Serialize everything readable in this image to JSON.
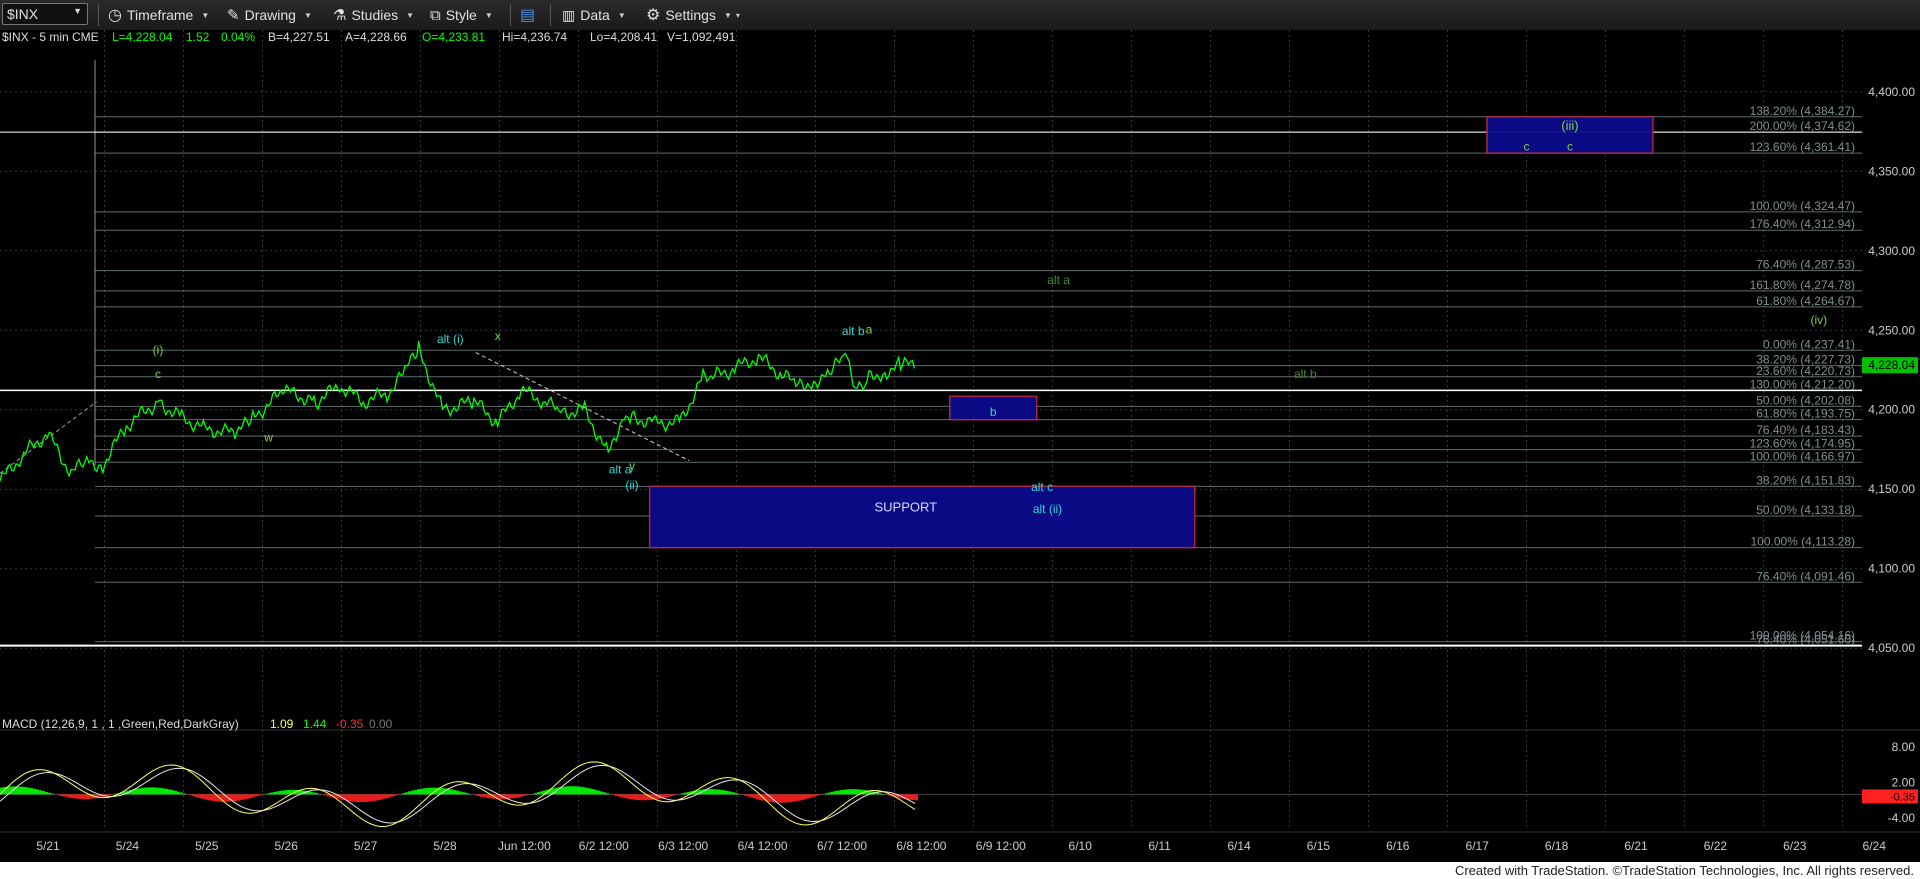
{
  "toolbar": {
    "symbol": "$INX",
    "timeframe": "Timeframe",
    "drawing": "Drawing",
    "studies": "Studies",
    "style": "Style",
    "data": "Data",
    "settings": "Settings"
  },
  "status_bar": {
    "prefix": "$INX - 5 min  CME",
    "last": "L=4,228.04",
    "change": "1.52",
    "change_pct": "0.04%",
    "bid": "B=4,227.51",
    "ask": "A=4,228.66",
    "open": "O=4,233.81",
    "high": "Hi=4,236.74",
    "low": "Lo=4,208.41",
    "volume": "V=1,092,491"
  },
  "colors": {
    "price_line": "#00ff00",
    "grid": "#2a3a3a",
    "fib_text": "#7f8f8f",
    "support_box": "#0b0b8c",
    "support_border": "#b0284a",
    "wave_label": "#2fd8d8",
    "green_label": "#7bd63a",
    "macd_line": "#ffff66",
    "signal_line": "#e8e8e8",
    "hist_up": "#00ff00",
    "hist_down": "#ff2020"
  },
  "chart_data": {
    "type": "line",
    "symbol": "$INX",
    "interval": "5 min",
    "ylim": [
      4030,
      4420
    ],
    "y_ticks": [
      "4,050.00",
      "4,100.00",
      "4,150.00",
      "4,200.00",
      "4,250.00",
      "4,300.00",
      "4,350.00",
      "4,400.00"
    ],
    "x_tick_labels": [
      "5/21",
      "5/24",
      "5/25",
      "5/26",
      "5/27",
      "5/28",
      "Jun 12:00",
      "6/2 12:00",
      "6/3 12:00",
      "6/4 12:00",
      "6/7 12:00",
      "6/8 12:00",
      "6/9 12:00",
      "6/10",
      "6/11",
      "6/14",
      "6/15",
      "6/16",
      "6/17",
      "6/18",
      "6/21",
      "6/22",
      "6/23",
      "6/24"
    ],
    "last_price_label": "4,228.04",
    "price_series": {
      "name": "$INX",
      "x_session": [
        0,
        0.3,
        0.6,
        0.9,
        1.1,
        1.3,
        1.6,
        2.0,
        2.3,
        2.6,
        3.0,
        3.2,
        3.6,
        4.0,
        4.3,
        4.6,
        4.9,
        5.1,
        5.3,
        5.6,
        6.0,
        6.3,
        6.6,
        6.9,
        7.1,
        7.4,
        7.7,
        7.9,
        8.0,
        8.3,
        8.6,
        8.9,
        9.0,
        9.3,
        9.6,
        9.9,
        10.1,
        10.3,
        10.5,
        10.7,
        10.85,
        11.0,
        11.2,
        11.4,
        11.6
      ],
      "price": [
        4155,
        4172,
        4185,
        4160,
        4168,
        4165,
        4190,
        4205,
        4195,
        4188,
        4185,
        4195,
        4212,
        4205,
        4215,
        4205,
        4210,
        4222,
        4238,
        4200,
        4205,
        4192,
        4212,
        4205,
        4198,
        4200,
        4172,
        4198,
        4195,
        4192,
        4192,
        4220,
        4220,
        4226,
        4233,
        4222,
        4215,
        4218,
        4222,
        4235,
        4212,
        4220,
        4224,
        4228,
        4228
      ]
    },
    "fib_levels": [
      {
        "label": "138.20% (4,384.27)",
        "value": 4384.27
      },
      {
        "label": "200.00% (4,374.62)",
        "value": 4374.62
      },
      {
        "label": "123.60% (4,361.41)",
        "value": 4361.41
      },
      {
        "label": "100.00% (4,324.47)",
        "value": 4324.47
      },
      {
        "label": "176.40% (4,312.94)",
        "value": 4312.94
      },
      {
        "label": "76.40% (4,287.53)",
        "value": 4287.53
      },
      {
        "label": "161.80% (4,274.78)",
        "value": 4274.78
      },
      {
        "label": "61.80% (4,264.67)",
        "value": 4264.67
      },
      {
        "label": "0.00% (4,237.41)",
        "value": 4237.41
      },
      {
        "label": "38.20% (4,227.73)",
        "value": 4227.73
      },
      {
        "label": "23.60% (4,220.73)",
        "value": 4220.73
      },
      {
        "label": "130.00% (4,212.20)",
        "value": 4212.2
      },
      {
        "label": "50.00% (4,202.08)",
        "value": 4202.08
      },
      {
        "label": "61.80% (4,193.75)",
        "value": 4193.75
      },
      {
        "label": "76.40% (4,183.43)",
        "value": 4183.43
      },
      {
        "label": "123.60% (4,174.95)",
        "value": 4174.95
      },
      {
        "label": "100.00% (4,166.97)",
        "value": 4166.97
      },
      {
        "label": "38.20% (4,151.83)",
        "value": 4151.83
      },
      {
        "label": "50.00% (4,133.18)",
        "value": 4133.18
      },
      {
        "label": "100.00% (4,113.28)",
        "value": 4113.28
      },
      {
        "label": "76.40% (4,091.46)",
        "value": 4091.46
      },
      {
        "label": "100.00% (4,054.16)",
        "value": 4054.16
      },
      {
        "label": "76.40% (4,051.60)",
        "value": 4051.6
      }
    ],
    "zones": [
      {
        "name": "(iii) target",
        "session_start": 18.0,
        "session_end": 20.1,
        "low": 4361.41,
        "high": 4384.27,
        "labels": [
          "(iii)",
          "c"
        ]
      },
      {
        "name": "b zone",
        "session_start": 11.2,
        "session_end": 12.3,
        "low": 4193.75,
        "high": 4208.4,
        "labels": [
          "b"
        ]
      },
      {
        "name": "SUPPORT",
        "session_start": 7.4,
        "session_end": 14.3,
        "low": 4113.28,
        "high": 4151.83,
        "labels": [
          "SUPPORT",
          "alt c",
          "alt (ii)"
        ]
      }
    ],
    "wave_labels": [
      {
        "text": "(i)",
        "session": 2.0,
        "value": 4235,
        "color": "green"
      },
      {
        "text": "c",
        "session": 2.0,
        "value": 4220,
        "color": "green"
      },
      {
        "text": "w",
        "session": 3.4,
        "value": 4180,
        "color": "green"
      },
      {
        "text": "alt (i)",
        "session": 5.7,
        "value": 4242,
        "color": "cyan"
      },
      {
        "text": "x",
        "session": 6.3,
        "value": 4244,
        "color": "green"
      },
      {
        "text": "alt a",
        "session": 7.85,
        "value": 4160,
        "color": "cyan"
      },
      {
        "text": "y",
        "session": 8.0,
        "value": 4162,
        "color": "green"
      },
      {
        "text": "(ii)",
        "session": 8.0,
        "value": 4150,
        "color": "cyan"
      },
      {
        "text": "alt b",
        "session": 10.8,
        "value": 4247,
        "color": "cyan"
      },
      {
        "text": "a",
        "session": 11.0,
        "value": 4248,
        "color": "green"
      },
      {
        "text": "alt a",
        "session": 13.4,
        "value": 4279,
        "color": "darkgreen"
      },
      {
        "text": "alt b",
        "session": 15.7,
        "value": 4220,
        "color": "darkgreen"
      },
      {
        "text": "(iv)",
        "session": 22.2,
        "value": 4254,
        "color": "green"
      },
      {
        "text": "c",
        "session": 18.5,
        "value": 4363,
        "color": "green"
      }
    ],
    "macd": {
      "label": "MACD (12,26,9, 1 , 1 ,Green,Red,DarkGray)",
      "macd_value": "1.09",
      "signal_value": "1.44",
      "hist_value": "-0.35",
      "zero_value": "0.00",
      "ylim": [
        -6,
        10
      ],
      "y_ticks": [
        "8.00",
        "2.00",
        "-4.00"
      ],
      "last_label": "-0.35"
    }
  },
  "footer": {
    "text": "Created with TradeStation. ©TradeStation Technologies, Inc. All rights reserved."
  }
}
